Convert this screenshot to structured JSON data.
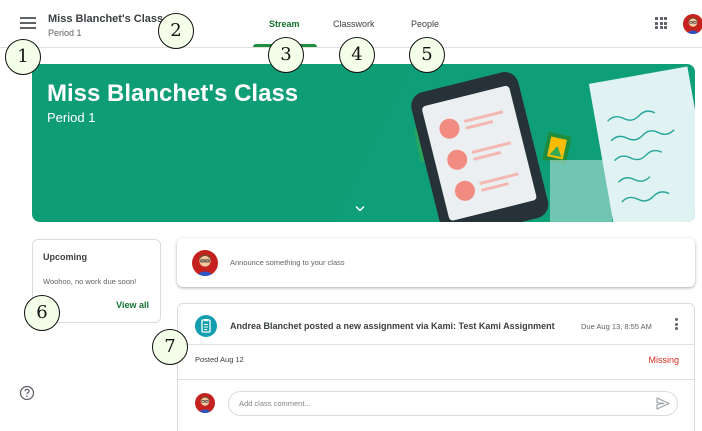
{
  "header": {
    "class_title": "Miss Blanchet's Class",
    "class_subtitle": "Period 1",
    "tabs": [
      {
        "label": "Stream",
        "active": true
      },
      {
        "label": "Classwork",
        "active": false
      },
      {
        "label": "People",
        "active": false
      }
    ]
  },
  "banner": {
    "title": "Miss Blanchet's Class",
    "subtitle": "Period 1",
    "background_color": "#0f9d76"
  },
  "upcoming": {
    "title": "Upcoming",
    "text": "Woohoo, no work due soon!",
    "link_label": "View all"
  },
  "announce": {
    "placeholder": "Announce something to your class"
  },
  "post": {
    "icon": "assignment-icon",
    "title": "Andrea Blanchet posted a new assignment via Kami: Test Kami Assignment",
    "due": "Due Aug 13, 8:55 AM",
    "posted": "Posted Aug 12",
    "status": "Missing",
    "status_color": "#d93025",
    "comment_placeholder": "Add class comment..."
  },
  "callouts": [
    "1",
    "2",
    "3",
    "4",
    "5",
    "6",
    "7"
  ],
  "colors": {
    "accent": "#137333",
    "assignment_icon": "#129eaf"
  }
}
